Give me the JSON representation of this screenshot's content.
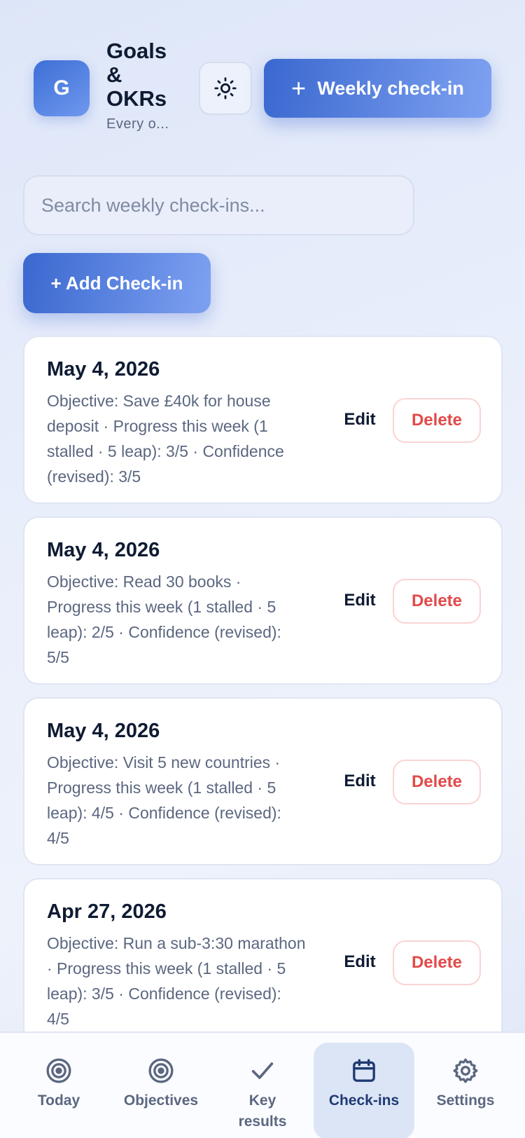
{
  "header": {
    "logo_letter": "G",
    "title": "Goals & OKRs",
    "subtitle": "Every o...",
    "theme_icon": "sun-icon",
    "weekly_button": {
      "icon": "plus-icon",
      "label": "Weekly check-in"
    }
  },
  "search": {
    "placeholder": "Search weekly check-ins...",
    "value": ""
  },
  "add_button_label": "+ Add Check-in",
  "checkins": [
    {
      "date": "May 4, 2026",
      "description": "Objective: Save £40k for house deposit · Progress this week (1 stalled · 5 leap): 3/5 · Confidence (revised): 3/5",
      "edit_label": "Edit",
      "delete_label": "Delete"
    },
    {
      "date": "May 4, 2026",
      "description": "Objective: Read 30 books · Progress this week (1 stalled · 5 leap): 2/5 · Confidence (revised): 5/5",
      "edit_label": "Edit",
      "delete_label": "Delete"
    },
    {
      "date": "May 4, 2026",
      "description": "Objective: Visit 5 new countries · Progress this week (1 stalled · 5 leap): 4/5 · Confidence (revised): 4/5",
      "edit_label": "Edit",
      "delete_label": "Delete"
    },
    {
      "date": "Apr 27, 2026",
      "description": "Objective: Run a sub-3:30 marathon · Progress this week (1 stalled · 5 leap): 3/5 · Confidence (revised): 4/5",
      "edit_label": "Edit",
      "delete_label": "Delete"
    }
  ],
  "nav": {
    "items": [
      {
        "label": "Today",
        "icon": "target-icon",
        "active": false
      },
      {
        "label": "Objectives",
        "icon": "target-icon",
        "active": false
      },
      {
        "label": "Key results",
        "icon": "check-icon",
        "active": false
      },
      {
        "label": "Check-ins",
        "icon": "calendar-icon",
        "active": true
      },
      {
        "label": "Settings",
        "icon": "gear-icon",
        "active": false
      }
    ]
  },
  "colors": {
    "accent": "#3a68cf",
    "accent_light": "#7ea1f1",
    "delete": "#e24a4a",
    "active_nav_bg": "#dce5f6"
  }
}
